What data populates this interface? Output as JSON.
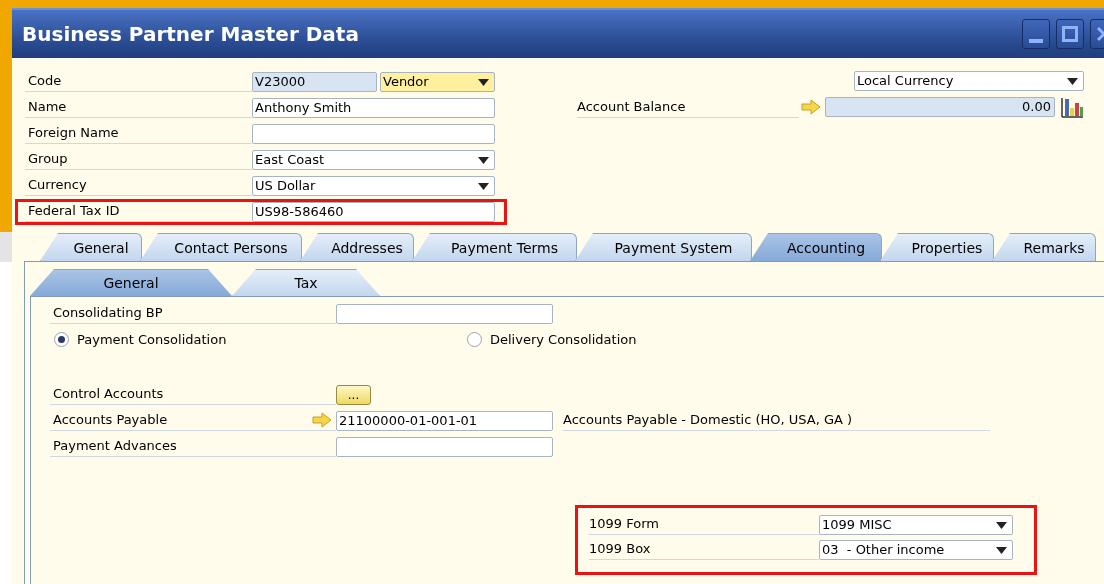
{
  "window": {
    "title": "Business Partner Master Data"
  },
  "header_fields": [
    {
      "label": "Code",
      "kind": "code",
      "value": "V23000",
      "type": "Vendor",
      "highlighted": false
    },
    {
      "label": "Name",
      "kind": "text",
      "value": "Anthony Smith",
      "highlighted": false
    },
    {
      "label": "Foreign Name",
      "kind": "text",
      "highlighted": false
    },
    {
      "label": "Group",
      "kind": "dropdown",
      "value": "East Coast",
      "highlighted": false
    },
    {
      "label": "Currency",
      "kind": "dropdown",
      "value": "US Dollar",
      "highlighted": false
    },
    {
      "label": "Federal Tax ID",
      "kind": "text",
      "value": "US98-586460",
      "highlighted": true
    }
  ],
  "balance": {
    "currency": "Local Currency",
    "label": "Account Balance",
    "value": "0.00"
  },
  "tabs": [
    {
      "label": "General",
      "selected": false
    },
    {
      "label": "Contact Persons",
      "selected": false
    },
    {
      "label": "Addresses",
      "selected": false
    },
    {
      "label": "Payment Terms",
      "selected": false
    },
    {
      "label": "Payment System",
      "selected": false
    },
    {
      "label": "Accounting",
      "selected": true
    },
    {
      "label": "Properties",
      "selected": false
    },
    {
      "label": "Remarks",
      "selected": false
    }
  ],
  "subtabs": [
    {
      "label": "General",
      "selected": true
    },
    {
      "label": "Tax",
      "selected": false
    }
  ],
  "accounting": {
    "consolidating_bp": {
      "label": "Consolidating BP"
    },
    "consolidation_options": [
      {
        "label": "Payment Consolidation",
        "selected": true
      },
      {
        "label": "Delivery Consolidation",
        "selected": false
      }
    ],
    "control_accounts": {
      "label": "Control Accounts",
      "button": "..."
    },
    "accounts_payable": {
      "label": "Accounts Payable",
      "value": "21100000-01-001-01",
      "description": "Accounts Payable - Domestic (HO, USA, GA )"
    },
    "payment_advances": {
      "label": "Payment Advances"
    },
    "form_1099": {
      "highlighted": true,
      "fields": [
        {
          "label": "1099 Form",
          "value": "1099 MISC"
        },
        {
          "label": "1099 Box",
          "value": "03  - Other income"
        }
      ]
    }
  }
}
